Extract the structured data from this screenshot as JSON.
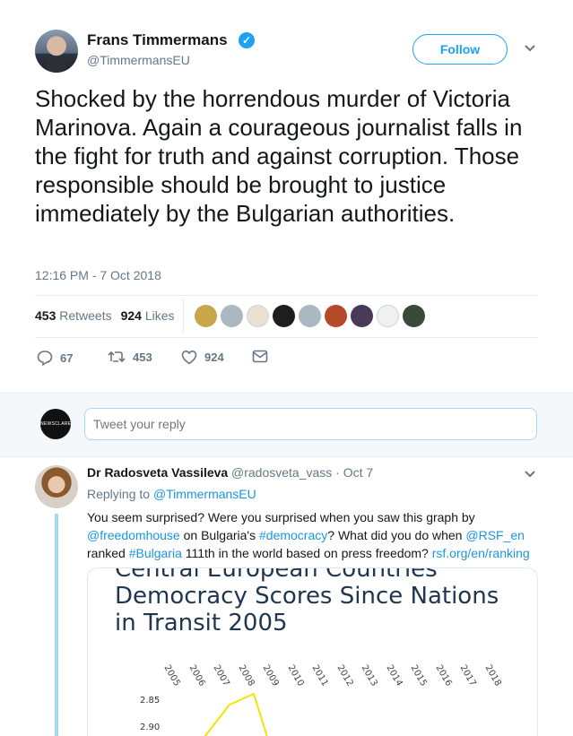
{
  "tweet": {
    "author_name": "Frans Timmermans",
    "author_handle": "@TimmermansEU",
    "verified_mark": "✓",
    "follow_label": "Follow",
    "text": "Shocked by the horrendous murder of Victoria Marinova. Again a courageous journalist falls in the fight for truth and against corruption. Those responsible should be brought to justice immediately by the Bulgarian authorities.",
    "timestamp": "12:16 PM - 7 Oct 2018",
    "retweets_count": "453",
    "retweets_label": "Retweets",
    "likes_count": "924",
    "likes_label": "Likes",
    "likers": [
      "#c8a64a",
      "#aab8c2",
      "#e8e0d0",
      "#1e1e1e",
      "#aab8c2",
      "#b44a2a",
      "#4a3a5a",
      "#f0f0f0",
      "#3a4a3a"
    ],
    "actions": {
      "reply_count": "67",
      "retweet_count": "453",
      "like_count": "924"
    }
  },
  "compose": {
    "avatar_text": "NEWSCLARE",
    "placeholder": "Tweet your reply"
  },
  "reply": {
    "author_name": "Dr Radosveta Vassileva",
    "author_handle": "@radosveta_vass · Oct 7",
    "replying_prefix": "Replying to",
    "replying_to": "@TimmermansEU",
    "text_parts": [
      {
        "t": "You seem surprised? Were you surprised when you saw this graph by "
      },
      {
        "t": "@freedomhouse",
        "link": true
      },
      {
        "t": " on Bulgaria's "
      },
      {
        "t": "#democracy",
        "link": true
      },
      {
        "t": "? What did you do when "
      },
      {
        "t": "@RSF_en",
        "link": true
      },
      {
        "t": " ranked "
      },
      {
        "t": "#Bulgaria",
        "link": true
      },
      {
        "t": " 111th in the world based on press freedom? "
      },
      {
        "t": "rsf.org/en/ranking",
        "link": true
      }
    ],
    "media": {
      "title_line1": "Central European Countries",
      "title_line2": "Democracy Scores Since Nations",
      "title_line3": "in Transit 2005",
      "years": [
        "2005",
        "2006",
        "2007",
        "2008",
        "2009",
        "2010",
        "2011",
        "2012",
        "2013",
        "2014",
        "2015",
        "2016",
        "2017",
        "2018"
      ],
      "y_ticks": [
        "2.85",
        "2.90"
      ]
    }
  },
  "colors": {
    "accent": "#1da1f2",
    "link": "#1b95e0",
    "muted": "#657786",
    "thread": "#a6d8f5"
  }
}
